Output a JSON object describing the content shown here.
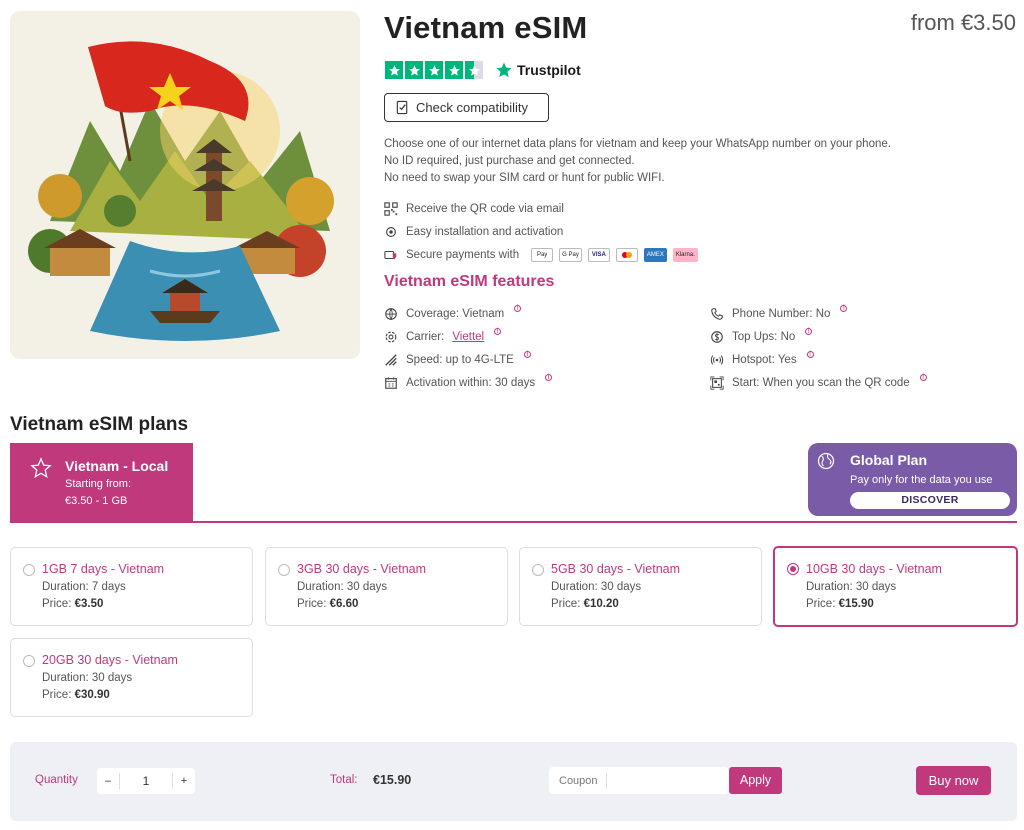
{
  "product": {
    "title": "Vietnam eSIM",
    "price_from": "from €3.50",
    "trustpilot_label": "Trustpilot",
    "rating_stars": 4.5,
    "check_button": "Check compatibility",
    "description": [
      "Choose one of our internet data plans for vietnam and keep your WhatsApp number on your phone.",
      "No ID required, just purchase and get connected.",
      "No need to swap your SIM card or hunt for public WIFI."
    ],
    "bullets": {
      "qr": "Receive the QR code via email",
      "install": "Easy installation and activation",
      "secure": "Secure payments with"
    },
    "payment_methods": [
      "Pay",
      "G Pay",
      "VISA",
      "mastercard",
      "AMEX",
      "Klarna."
    ]
  },
  "features": {
    "title": "Vietnam eSIM features",
    "coverage": "Coverage: Vietnam",
    "carrier_prefix": "Carrier:",
    "carrier_link": "Viettel",
    "speed": "Speed: up to 4G-LTE",
    "activation": "Activation within: 30 days",
    "phone": "Phone Number: No",
    "topups": "Top Ups: No",
    "hotspot": "Hotspot: Yes",
    "start": "Start: When you scan the QR code",
    "info_glyph": "i"
  },
  "plans_section": {
    "title": "Vietnam eSIM plans",
    "local_tab": {
      "title": "Vietnam - Local",
      "subtitle": "Starting from:",
      "detail": "€3.50 - 1 GB"
    },
    "global": {
      "title": "Global Plan",
      "subtitle": "Pay only for the data you use",
      "button": "DISCOVER"
    },
    "plans": [
      {
        "name": "1GB 7 days - Vietnam",
        "duration": "Duration: 7 days",
        "price_label": "Price:",
        "price": "€3.50",
        "selected": false
      },
      {
        "name": "3GB 30 days - Vietnam",
        "duration": "Duration: 30 days",
        "price_label": "Price:",
        "price": "€6.60",
        "selected": false
      },
      {
        "name": "5GB 30 days - Vietnam",
        "duration": "Duration: 30 days",
        "price_label": "Price:",
        "price": "€10.20",
        "selected": false
      },
      {
        "name": "10GB 30 days - Vietnam",
        "duration": "Duration: 30 days",
        "price_label": "Price:",
        "price": "€15.90",
        "selected": true
      },
      {
        "name": "20GB 30 days - Vietnam",
        "duration": "Duration: 30 days",
        "price_label": "Price:",
        "price": "€30.90",
        "selected": false
      }
    ]
  },
  "checkout": {
    "quantity_label": "Quantity",
    "minus": "–",
    "quantity": "1",
    "plus": "+",
    "total_label": "Total:",
    "total": "€15.90",
    "coupon_label": "Coupon",
    "coupon_value": "",
    "apply": "Apply",
    "buy": "Buy now"
  },
  "colors": {
    "accent": "#c0397d",
    "global_card": "#7a5ba8",
    "trustpilot_green": "#00b67a"
  }
}
